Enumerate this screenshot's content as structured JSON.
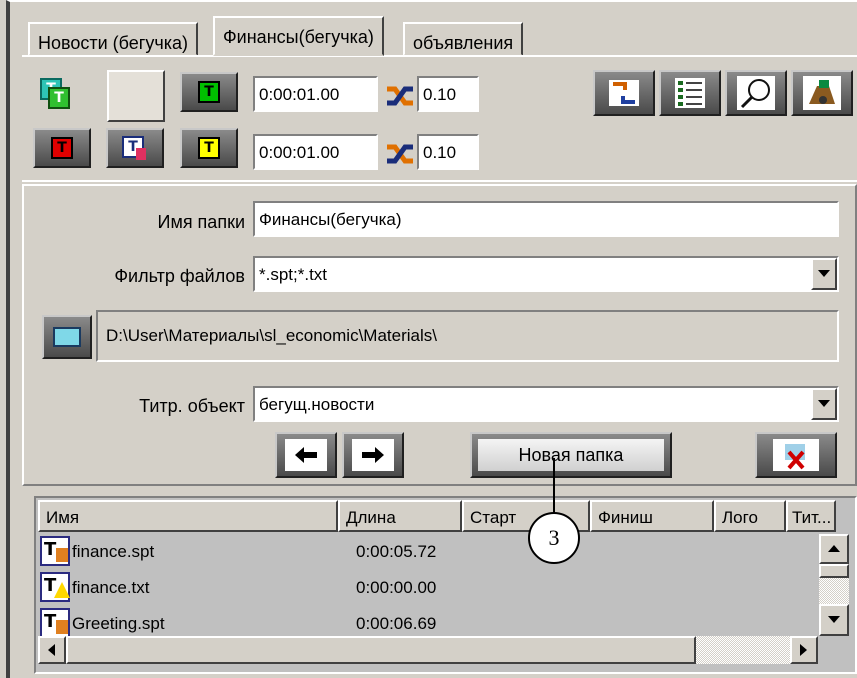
{
  "tabs": [
    {
      "label": "Новости (бегучка)"
    },
    {
      "label": "Финансы(бегучка)"
    },
    {
      "label": "объявления"
    }
  ],
  "toolbar": {
    "row1_time": "0:00:01.00",
    "row1_speed": "0.10",
    "row2_time": "0:00:01.00",
    "row2_speed": "0.10"
  },
  "form": {
    "folder_name_label": "Имя папки",
    "folder_name_value": "Финансы(бегучка)",
    "file_filter_label": "Фильтр файлов",
    "file_filter_value": "*.spt;*.txt",
    "path_value": "D:\\User\\Материалы\\sl_economic\\Materials\\",
    "title_object_label": "Титр. объект",
    "title_object_value": "бегущ.новости"
  },
  "buttons": {
    "new_folder": "Новая папка"
  },
  "callout": {
    "number": "3"
  },
  "table": {
    "columns": [
      "Имя",
      "Длина",
      "Старт",
      "Финиш",
      "Лого",
      "Тит..."
    ],
    "rows": [
      {
        "name": "finance.spt",
        "length": "0:00:05.72",
        "icon": "spt-file-icon"
      },
      {
        "name": "finance.txt",
        "length": "0:00:00.00",
        "icon": "txt-warning-file-icon"
      },
      {
        "name": "Greeting.spt",
        "length": "0:00:06.69",
        "icon": "spt-file-icon"
      }
    ]
  },
  "colors": {
    "window_bg": "#d4d0c8",
    "list_bg": "#c0c0c0",
    "green": "#00c000",
    "red": "#e00000",
    "yellow": "#ffff00",
    "shuffle_orange": "#e08000",
    "folder_cyan": "#7fd8e8"
  }
}
